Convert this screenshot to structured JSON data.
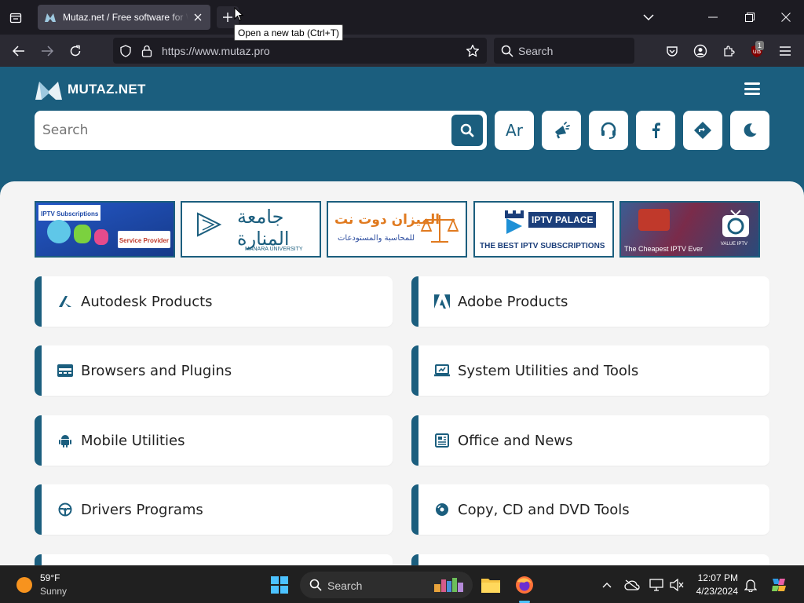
{
  "browser": {
    "tab_title": "Mutaz.net / Free software for Windows",
    "newtab_tooltip": "Open a new tab (Ctrl+T)",
    "url": "https://www.mutaz.pro",
    "search_placeholder": "Search",
    "extension_badge": "1"
  },
  "site": {
    "logo_text": "MUTAZ.NET",
    "search_placeholder": "Search",
    "lang_button": "Ar",
    "brand_color": "#1b5e7e",
    "ads": [
      {
        "text": "IPTV Subscriptions",
        "sub": "Service Provider"
      },
      {
        "text": "جامعة المنارة",
        "sub": "MANARA UNIVERSITY"
      },
      {
        "text": "الميزان دوت نت",
        "sub": "للمحاسبة والمستودعات"
      },
      {
        "text": "IPTV PALACE",
        "sub": "THE BEST IPTV SUBSCRIPTIONS"
      },
      {
        "text": "The Cheapest IPTV Ever",
        "sub": "VALUE IPTV"
      }
    ],
    "categories": [
      {
        "label": "Autodesk Products",
        "icon": "autodesk-icon"
      },
      {
        "label": "Adobe Products",
        "icon": "adobe-icon"
      },
      {
        "label": "Browsers and Plugins",
        "icon": "browser-window-icon"
      },
      {
        "label": "System Utilities and Tools",
        "icon": "laptop-tools-icon"
      },
      {
        "label": "Mobile Utilities",
        "icon": "android-icon"
      },
      {
        "label": "Office and News",
        "icon": "newspaper-icon"
      },
      {
        "label": "Drivers Programs",
        "icon": "steering-wheel-icon"
      },
      {
        "label": "Copy, CD and DVD Tools",
        "icon": "disc-icon"
      }
    ]
  },
  "taskbar": {
    "temperature": "59°F",
    "condition": "Sunny",
    "search_placeholder": "Search",
    "time": "12:07 PM",
    "date": "4/23/2024"
  }
}
